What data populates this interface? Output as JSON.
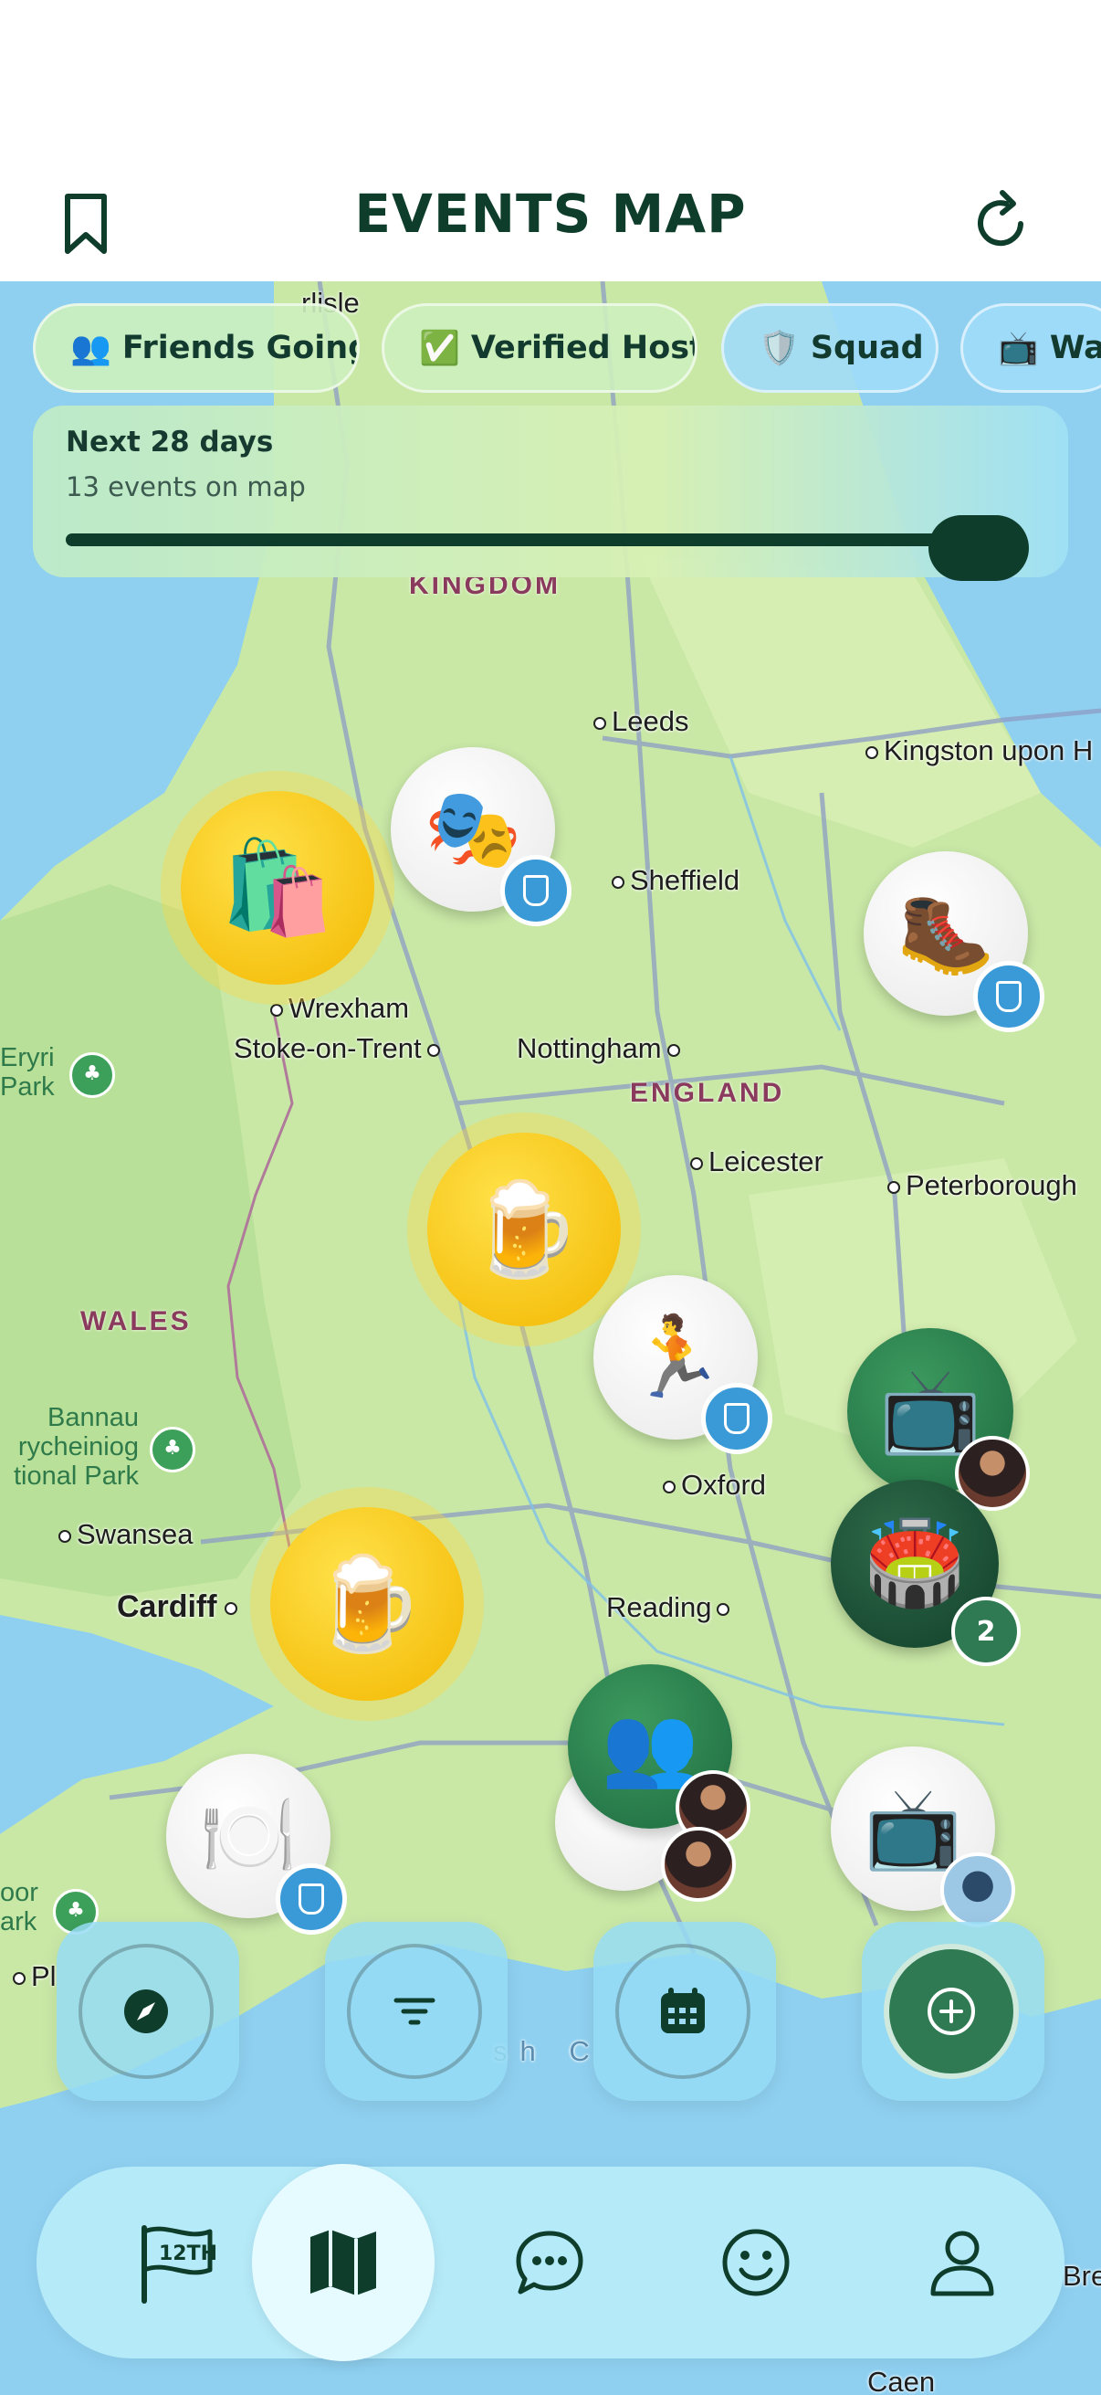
{
  "header": {
    "title": "EVENTS MAP",
    "left_icon": "bookmark-icon",
    "right_icon": "refresh-icon"
  },
  "filters": [
    {
      "emoji": "👥",
      "label": "Friends Going"
    },
    {
      "emoji": "✅",
      "label": "Verified Host"
    },
    {
      "emoji": "🛡️",
      "label": "Squad"
    },
    {
      "emoji": "📺",
      "label": "Wat"
    }
  ],
  "range": {
    "label": "Next 28 days",
    "summary": "13 events on map",
    "fill": 1.0
  },
  "map": {
    "places": {
      "carlisle": "rlisle",
      "leeds": "Leeds",
      "kingston": "Kingston upon H",
      "sheffield": "Sheffield",
      "wrexham": "Wrexham",
      "stoke": "Stoke-on-Trent",
      "nottingham": "Nottingham",
      "leicester": "Leicester",
      "peterborough": "Peterborough",
      "oxford": "Oxford",
      "swansea": "Swansea",
      "cardiff": "Cardiff",
      "reading": "Reading",
      "pl": "Pl",
      "caen": "Caen",
      "bre": "Bre"
    },
    "regions": {
      "kingdom": "KINGDOM",
      "england": "ENGLAND",
      "wales": "WALES"
    },
    "parks": {
      "eryri": [
        "Eryri",
        "Park"
      ],
      "bannau": [
        "Bannau",
        "rycheiniog",
        "tional Park"
      ],
      "moor": [
        "oor",
        "ark"
      ]
    },
    "sea_label": "sh C",
    "cluster_count": "2"
  },
  "pins": [
    {
      "name": "shopping",
      "emoji": "🛍️"
    },
    {
      "name": "theatre",
      "emoji": "🎭"
    },
    {
      "name": "hiking",
      "emoji": "🥾"
    },
    {
      "name": "beer-1",
      "emoji": "🍺"
    },
    {
      "name": "running",
      "emoji": "🏃"
    },
    {
      "name": "tv-1",
      "emoji": "📺"
    },
    {
      "name": "stadium",
      "emoji": "🏟️"
    },
    {
      "name": "beer-2",
      "emoji": "🍺"
    },
    {
      "name": "dining",
      "emoji": "🍽️"
    },
    {
      "name": "friends",
      "emoji": "👥"
    },
    {
      "name": "tv-2",
      "emoji": "📺"
    }
  ],
  "controls": [
    "compass-icon",
    "filter-icon",
    "calendar-icon",
    "add-icon"
  ],
  "tabs": [
    {
      "name": "home",
      "icon": "flag-12th-icon",
      "label": "12TH"
    },
    {
      "name": "map",
      "icon": "map-icon"
    },
    {
      "name": "chat",
      "icon": "chat-icon"
    },
    {
      "name": "social",
      "icon": "smiley-icon"
    },
    {
      "name": "profile",
      "icon": "person-icon"
    }
  ],
  "colors": {
    "brand_dark": "#0f3d2c",
    "accent_green": "#2f7a52",
    "water": "#8fd0f0",
    "land": "#c9e8a6"
  }
}
